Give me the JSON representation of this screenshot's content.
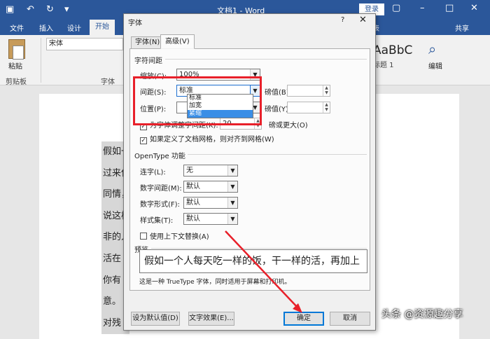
{
  "word": {
    "title": "文档1 - Word",
    "login": "登录",
    "tabs": [
      "文件",
      "插入",
      "设计"
    ],
    "active_tab": "开始",
    "tab_right": "表",
    "share": "共享",
    "paste": "粘贴",
    "clipboard_group": "剪贴板",
    "font_name": "宋体",
    "font_group": "字体",
    "styles_preview": "AaBbC",
    "styles_caption": "标题 1",
    "edit_label": "编辑"
  },
  "document": {
    "lines": [
      "假如一",
      "过来使",
      "同情，",
      "说这样",
      "非的人",
      "活在",
      "你有",
      "意。",
      "对残"
    ]
  },
  "dialog": {
    "title": "字体",
    "help": "?",
    "tab_font": "字体(N)",
    "tab_advanced": "高级(V)",
    "char_spacing_title": "字符间距",
    "scale_label": "缩放(C):",
    "scale_value": "100%",
    "spacing_label": "间距(S):",
    "spacing_value": "标准",
    "spacing_options": [
      "标准",
      "加宽",
      "紧缩"
    ],
    "spacing_selected": "紧缩",
    "points_label_b": "磅值(B):",
    "position_label": "位置(P):",
    "points_label_y": "磅值(Y):",
    "kerning_label": "为字体调整字间距(K):",
    "kerning_value": "20",
    "kerning_suffix": "磅或更大(O)",
    "grid_label": "如果定义了文档网格，则对齐到网格(W)",
    "opentype_title": "OpenType 功能",
    "ligatures_label": "连字(L):",
    "ligatures_value": "无",
    "num_spacing_label": "数字间距(M):",
    "num_spacing_value": "默认",
    "num_forms_label": "数字形式(F):",
    "num_forms_value": "默认",
    "style_sets_label": "样式集(T):",
    "style_sets_value": "默认",
    "contextual_label": "使用上下文替换(A)",
    "preview_title": "预览",
    "preview_text": "假如一个人每天吃一样的饭，干一样的活，再加上",
    "preview_note": "这是一种 TrueType 字体，同时适用于屏幕和打印机。",
    "set_default": "设为默认值(D)",
    "text_effects": "文字效果(E)...",
    "ok": "确定",
    "cancel": "取消"
  },
  "watermark": "头条 @资源趣分享",
  "colors": {
    "word_blue": "#2b579a",
    "highlight_red": "#e8202a",
    "selected_item": "#3a8ee6"
  }
}
